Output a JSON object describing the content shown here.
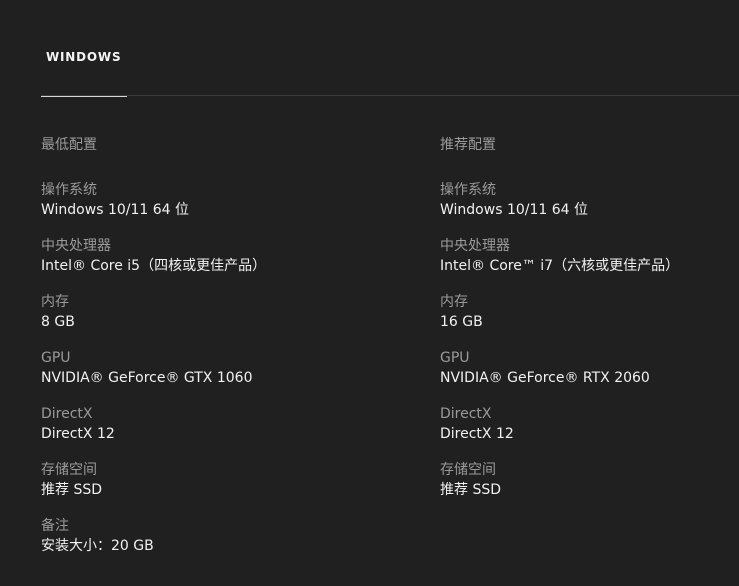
{
  "tabs": [
    {
      "label": "WINDOWS",
      "active": true
    }
  ],
  "minimum": {
    "title": "最低配置",
    "specs": [
      {
        "label": "操作系统",
        "value": "Windows 10/11 64 位"
      },
      {
        "label": "中央处理器",
        "value": "Intel® Core i5（四核或更佳产品）"
      },
      {
        "label": "内存",
        "value": "8 GB"
      },
      {
        "label": "GPU",
        "value": "NVIDIA® GeForce® GTX 1060"
      },
      {
        "label": "DirectX",
        "value": "DirectX 12"
      },
      {
        "label": "存储空间",
        "value": "推荐 SSD"
      },
      {
        "label": "备注",
        "value": "安装大小：20 GB"
      }
    ]
  },
  "recommended": {
    "title": "推荐配置",
    "specs": [
      {
        "label": "操作系统",
        "value": "Windows 10/11 64 位"
      },
      {
        "label": "中央处理器",
        "value": "Intel® Core™ i7（六核或更佳产品）"
      },
      {
        "label": "内存",
        "value": "16 GB"
      },
      {
        "label": "GPU",
        "value": "NVIDIA® GeForce® RTX 2060"
      },
      {
        "label": "DirectX",
        "value": "DirectX 12"
      },
      {
        "label": "存储空间",
        "value": "推荐 SSD"
      }
    ]
  },
  "colors": {
    "background": "#202020",
    "label": "#9a9a9a",
    "value": "#f1f1f1",
    "active_tab_underline": "#d8d8d8"
  }
}
